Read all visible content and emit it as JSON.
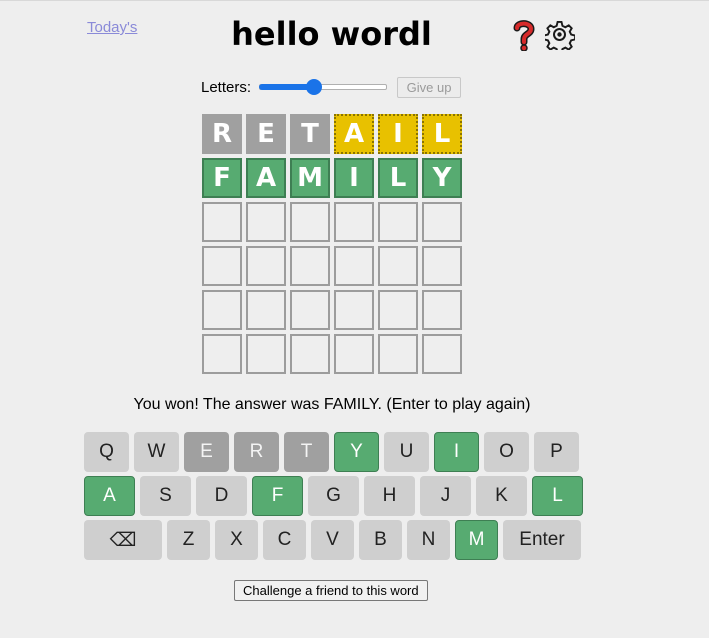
{
  "header": {
    "todays_link": "Today's",
    "title": "hello wordl",
    "help_icon": "question-mark-icon",
    "settings_icon": "gear-icon"
  },
  "controls": {
    "letters_label": "Letters:",
    "letters_value": 6,
    "letters_min": 4,
    "letters_max": 11,
    "give_up_label": "Give up"
  },
  "board": {
    "rows": [
      [
        {
          "l": "R",
          "s": "absent"
        },
        {
          "l": "E",
          "s": "absent"
        },
        {
          "l": "T",
          "s": "absent"
        },
        {
          "l": "A",
          "s": "elsewhere"
        },
        {
          "l": "I",
          "s": "elsewhere"
        },
        {
          "l": "L",
          "s": "elsewhere"
        }
      ],
      [
        {
          "l": "F",
          "s": "correct"
        },
        {
          "l": "A",
          "s": "correct"
        },
        {
          "l": "M",
          "s": "correct"
        },
        {
          "l": "I",
          "s": "correct"
        },
        {
          "l": "L",
          "s": "correct"
        },
        {
          "l": "Y",
          "s": "correct"
        }
      ],
      [
        {
          "l": "",
          "s": "empty"
        },
        {
          "l": "",
          "s": "empty"
        },
        {
          "l": "",
          "s": "empty"
        },
        {
          "l": "",
          "s": "empty"
        },
        {
          "l": "",
          "s": "empty"
        },
        {
          "l": "",
          "s": "empty"
        }
      ],
      [
        {
          "l": "",
          "s": "empty"
        },
        {
          "l": "",
          "s": "empty"
        },
        {
          "l": "",
          "s": "empty"
        },
        {
          "l": "",
          "s": "empty"
        },
        {
          "l": "",
          "s": "empty"
        },
        {
          "l": "",
          "s": "empty"
        }
      ],
      [
        {
          "l": "",
          "s": "empty"
        },
        {
          "l": "",
          "s": "empty"
        },
        {
          "l": "",
          "s": "empty"
        },
        {
          "l": "",
          "s": "empty"
        },
        {
          "l": "",
          "s": "empty"
        },
        {
          "l": "",
          "s": "empty"
        }
      ],
      [
        {
          "l": "",
          "s": "empty"
        },
        {
          "l": "",
          "s": "empty"
        },
        {
          "l": "",
          "s": "empty"
        },
        {
          "l": "",
          "s": "empty"
        },
        {
          "l": "",
          "s": "empty"
        },
        {
          "l": "",
          "s": "empty"
        }
      ]
    ]
  },
  "message": "You won! The answer was FAMILY. (Enter to play again)",
  "keyboard": {
    "rows": [
      [
        {
          "k": "Q",
          "s": "unused"
        },
        {
          "k": "W",
          "s": "unused"
        },
        {
          "k": "E",
          "s": "absent"
        },
        {
          "k": "R",
          "s": "absent"
        },
        {
          "k": "T",
          "s": "absent"
        },
        {
          "k": "Y",
          "s": "correct"
        },
        {
          "k": "U",
          "s": "unused"
        },
        {
          "k": "I",
          "s": "correct"
        },
        {
          "k": "O",
          "s": "unused"
        },
        {
          "k": "P",
          "s": "unused"
        }
      ],
      [
        {
          "k": "A",
          "s": "correct"
        },
        {
          "k": "S",
          "s": "unused"
        },
        {
          "k": "D",
          "s": "unused"
        },
        {
          "k": "F",
          "s": "correct"
        },
        {
          "k": "G",
          "s": "unused"
        },
        {
          "k": "H",
          "s": "unused"
        },
        {
          "k": "J",
          "s": "unused"
        },
        {
          "k": "K",
          "s": "unused"
        },
        {
          "k": "L",
          "s": "correct"
        }
      ],
      [
        {
          "k": "⌫",
          "s": "unused"
        },
        {
          "k": "Z",
          "s": "unused"
        },
        {
          "k": "X",
          "s": "unused"
        },
        {
          "k": "C",
          "s": "unused"
        },
        {
          "k": "V",
          "s": "unused"
        },
        {
          "k": "B",
          "s": "unused"
        },
        {
          "k": "N",
          "s": "unused"
        },
        {
          "k": "M",
          "s": "correct"
        },
        {
          "k": "Enter",
          "s": "unused"
        }
      ]
    ]
  },
  "challenge_label": "Challenge a friend to this word",
  "colors": {
    "correct": "#57ab71",
    "elsewhere": "#e8c100",
    "absent": "#a0a0a0",
    "key": "#cfcfcf",
    "accent": "#1a73e8"
  }
}
